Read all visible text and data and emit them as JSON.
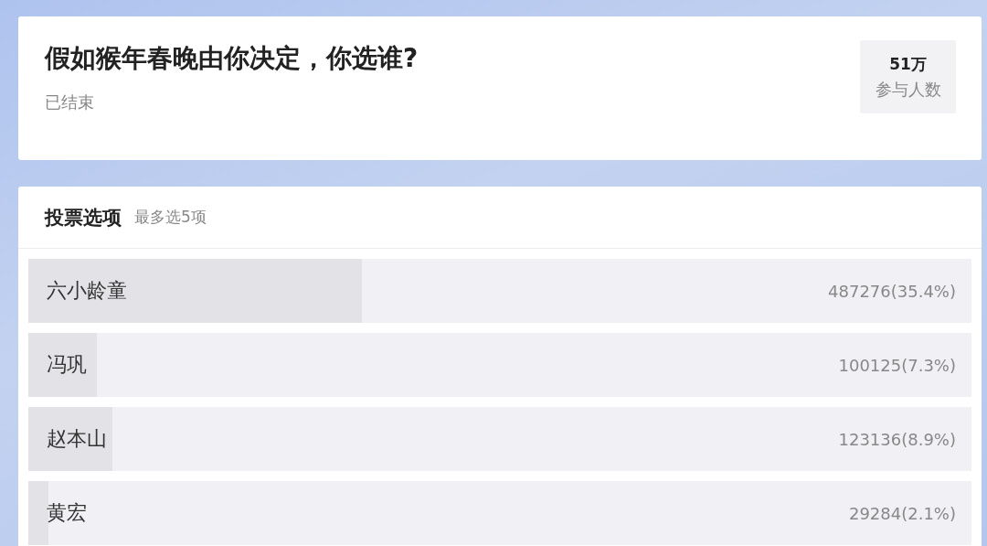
{
  "poll": {
    "title": "假如猴年春晚由你决定，你选谁?",
    "status": "已结束",
    "participants": {
      "count": "51万",
      "label": "参与人数"
    }
  },
  "options_section": {
    "title": "投票选项",
    "hint": "最多选5项"
  },
  "options": [
    {
      "name": "六小龄童",
      "result": "487276(35.4%)",
      "level": 0.354
    },
    {
      "name": "冯巩",
      "result": "100125(7.3%)",
      "level": 0.073
    },
    {
      "name": "赵本山",
      "result": "123136(8.9%)",
      "level": 0.089
    },
    {
      "name": "黄宏",
      "result": "29284(2.1%)",
      "level": 0.021
    }
  ]
}
